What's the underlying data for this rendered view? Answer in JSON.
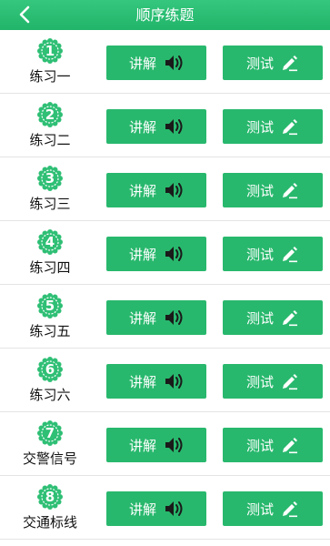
{
  "header": {
    "title": "顺序练题",
    "back_icon": "chevron-left-icon"
  },
  "colors": {
    "accent": "#28b86d",
    "header": "#21b56a",
    "badge": "#2fbf75"
  },
  "items": [
    {
      "num": "1",
      "label": "练习一"
    },
    {
      "num": "2",
      "label": "练习二"
    },
    {
      "num": "3",
      "label": "练习三"
    },
    {
      "num": "4",
      "label": "练习四"
    },
    {
      "num": "5",
      "label": "练习五"
    },
    {
      "num": "6",
      "label": "练习六"
    },
    {
      "num": "7",
      "label": "交警信号"
    },
    {
      "num": "8",
      "label": "交通标线"
    }
  ],
  "buttons": {
    "listen_label": "讲解",
    "listen_icon": "speaker-icon",
    "test_label": "测试",
    "test_icon": "pencil-icon"
  }
}
